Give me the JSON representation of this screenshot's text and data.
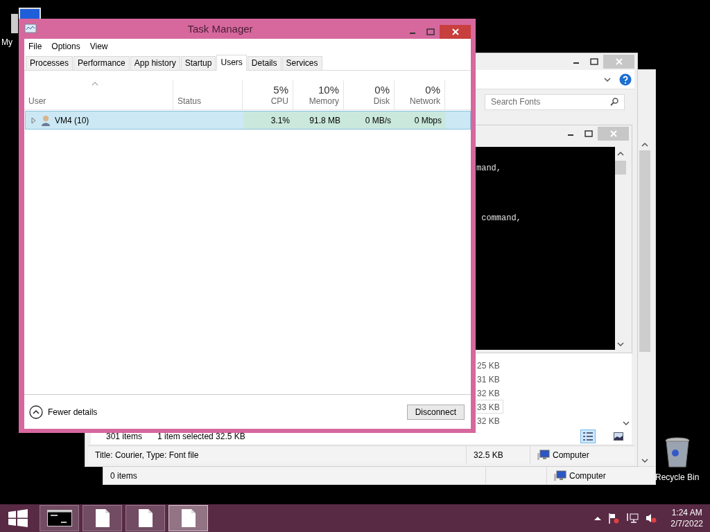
{
  "desktop_icons": [
    {
      "kind": "computer",
      "label": "My"
    },
    {
      "kind": "recycle_bin",
      "label": "Recycle Bin"
    }
  ],
  "back_window": {
    "status": "0 items",
    "zone": "Computer"
  },
  "fonts_window": {
    "search": {
      "placeholder": "Search Fonts"
    },
    "sizes": [
      {
        "text": "25 KB",
        "selected": false
      },
      {
        "text": "31 KB",
        "selected": false
      },
      {
        "text": "32 KB",
        "selected": false
      },
      {
        "text": "33 KB",
        "selected": true
      },
      {
        "text": "32 KB",
        "selected": false
      }
    ],
    "status": {
      "count": "301 items",
      "selection": "1 item selected  32.5 KB"
    },
    "views": [
      {
        "kind": "details",
        "selected": true
      },
      {
        "kind": "tiles",
        "selected": false
      }
    ],
    "details_bar": {
      "info": "Title: Courier, Type: Font file",
      "size": "32.5 KB",
      "zone": "Computer"
    }
  },
  "console_window": {
    "lines": [
      "mand,",
      " command,"
    ]
  },
  "task_manager": {
    "title": "Task Manager",
    "menu": [
      "File",
      "Options",
      "View"
    ],
    "tabs": [
      {
        "label": "Processes",
        "selected": false
      },
      {
        "label": "Performance",
        "selected": false
      },
      {
        "label": "App history",
        "selected": false
      },
      {
        "label": "Startup",
        "selected": false
      },
      {
        "label": "Users",
        "selected": true
      },
      {
        "label": "Details",
        "selected": false
      },
      {
        "label": "Services",
        "selected": false
      }
    ],
    "columns": [
      {
        "label": "User",
        "sorted": true
      },
      {
        "label": "Status",
        "sorted": false
      },
      {
        "label": "CPU",
        "percent": "5%",
        "sorted": false
      },
      {
        "label": "Memory",
        "percent": "10%",
        "sorted": false
      },
      {
        "label": "Disk",
        "percent": "0%",
        "sorted": false
      },
      {
        "label": "Network",
        "percent": "0%",
        "sorted": false
      }
    ],
    "rows": [
      {
        "user": "VM4 (10)",
        "cpu": "3.1%",
        "memory": "91.8 MB",
        "disk": "0 MB/s",
        "network": "0 Mbps",
        "selected": true,
        "expanded": false
      }
    ],
    "footer": {
      "toggle": "Fewer details",
      "button": "Disconnect"
    }
  },
  "taskbar": {
    "buttons": [
      {
        "kind": "console",
        "selected": false
      },
      {
        "kind": "document",
        "selected": false
      },
      {
        "kind": "document",
        "selected": false
      },
      {
        "kind": "document",
        "selected": true
      }
    ],
    "time": "1:24 AM",
    "date": "2/7/2022"
  }
}
